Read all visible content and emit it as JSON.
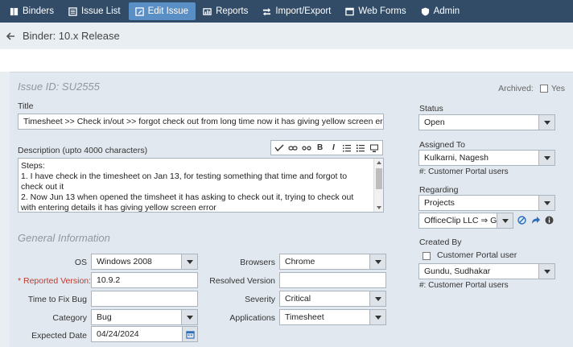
{
  "nav": {
    "items": [
      {
        "label": "Binders",
        "icon": "binders-icon"
      },
      {
        "label": "Issue List",
        "icon": "list-icon"
      },
      {
        "label": "Edit Issue",
        "icon": "edit-icon",
        "active": true
      },
      {
        "label": "Reports",
        "icon": "reports-icon"
      },
      {
        "label": "Import/Export",
        "icon": "import-export-icon"
      },
      {
        "label": "Web Forms",
        "icon": "web-forms-icon"
      },
      {
        "label": "Admin",
        "icon": "shield-icon"
      }
    ]
  },
  "breadcrumb": {
    "title": "Binder: 10.x Release"
  },
  "issue": {
    "id_label": "Issue ID: SU2555",
    "archived_label": "Archived:",
    "archived_yes": "Yes",
    "title_label": "Title",
    "title_value": "Timesheet >> Check in/out >> forgot check out from long time now it has giving yellow screen error",
    "description_label": "Description (upto 4000 characters)",
    "description_lines": [
      "Steps:",
      "1. I have check in the timesheet on Jan 13, for testing something that time and forgot to check out it",
      "2. Now Jun 13 when opened the timsheet it has asking to check out it, trying to check out with entering details it has giving yellow screen error"
    ],
    "toolbar": {
      "bold": "B",
      "italic": "I"
    }
  },
  "general": {
    "section_title": "General Information",
    "os_label": "OS",
    "os_value": "Windows 2008",
    "reported_version_label": "* Reported Version:",
    "reported_version_value": "10.9.2",
    "time_to_fix_label": "Time to Fix Bug",
    "time_to_fix_value": "",
    "category_label": "Category",
    "category_value": "Bug",
    "expected_date_label": "Expected Date",
    "expected_date_value": "04/24/2024",
    "browsers_label": "Browsers",
    "browsers_value": "Chrome",
    "resolved_version_label": "Resolved Version",
    "resolved_version_value": "",
    "severity_label": "Severity",
    "severity_value": "Critical",
    "applications_label": "Applications",
    "applications_value": "Timesheet"
  },
  "side": {
    "status_label": "Status",
    "status_value": "Open",
    "assigned_label": "Assigned To",
    "assigned_value": "Kulkarni, Nagesh",
    "assigned_hint": "#: Customer Portal users",
    "regarding_label": "Regarding",
    "regarding_value": "Projects",
    "regarding_sub_value": "OfficeClip LLC ⇒ G...",
    "created_by_label": "Created By",
    "customer_portal_user_label": "Customer Portal user",
    "created_by_value": "Gundu, Sudhakar",
    "created_hint": "#: Customer Portal users"
  },
  "colors": {
    "nav_bg": "#324c68",
    "nav_active": "#5a8fc6",
    "required": "#c0392b",
    "link_blue": "#2a6ebb"
  }
}
